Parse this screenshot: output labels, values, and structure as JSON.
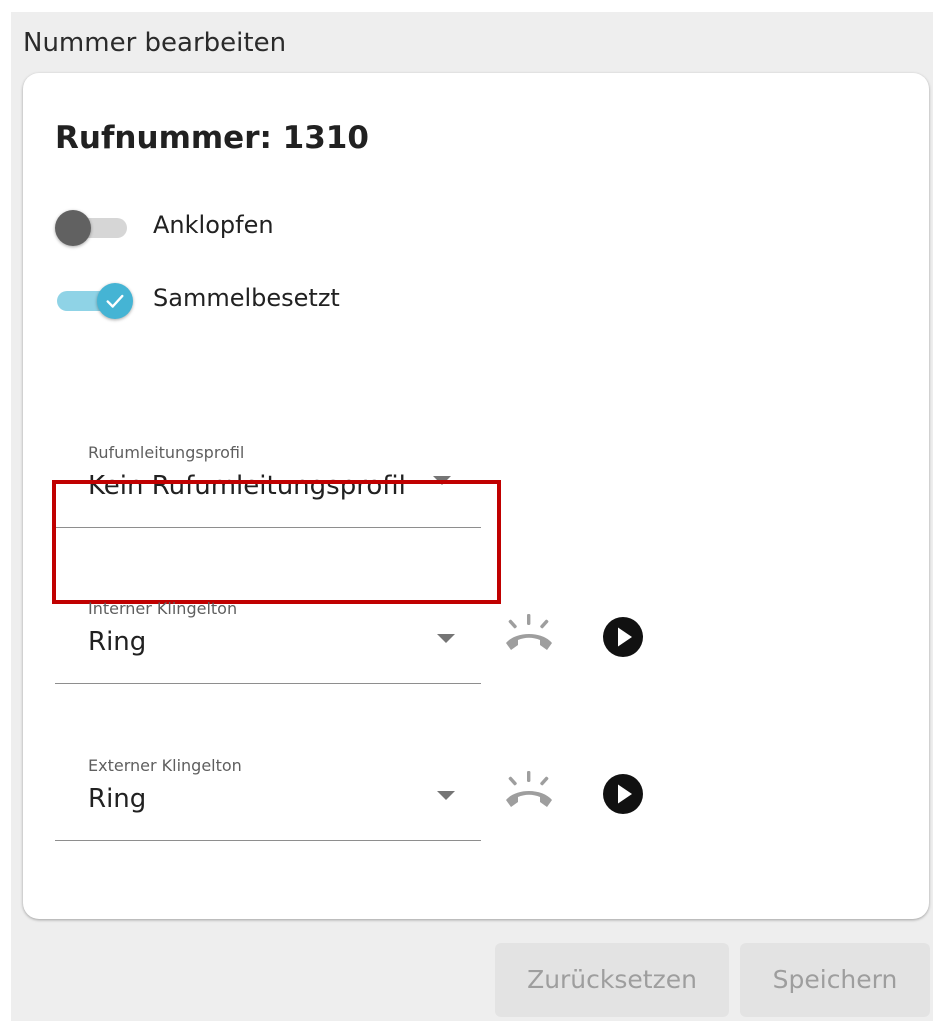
{
  "page": {
    "title": "Nummer bearbeiten"
  },
  "card": {
    "title": "Rufnummer: 1310",
    "toggles": [
      {
        "label": "Anklopfen",
        "checked": false
      },
      {
        "label": "Sammelbesetzt",
        "checked": true
      }
    ],
    "forwarding_profile": {
      "label": "Rufumleitungsprofil",
      "value": "Kein Rufumleitungsprofil"
    },
    "internal_ringtone": {
      "label": "Interner Klingelton",
      "value": "Ring",
      "ring_icon": "ringing-phone-icon",
      "play_icon": "play-circle-icon"
    },
    "external_ringtone": {
      "label": "Externer Klingelton",
      "value": "Ring",
      "ring_icon": "ringing-phone-icon",
      "play_icon": "play-circle-icon"
    }
  },
  "footer": {
    "reset_label": "Zurücksetzen",
    "save_label": "Speichern"
  },
  "colors": {
    "accent": "#45b4d4",
    "accent_track": "#8fd3e6",
    "highlight": "#c00000",
    "page_background": "#eeeeee",
    "button_background": "#e3e3e3",
    "button_text": "#9e9e9e"
  }
}
